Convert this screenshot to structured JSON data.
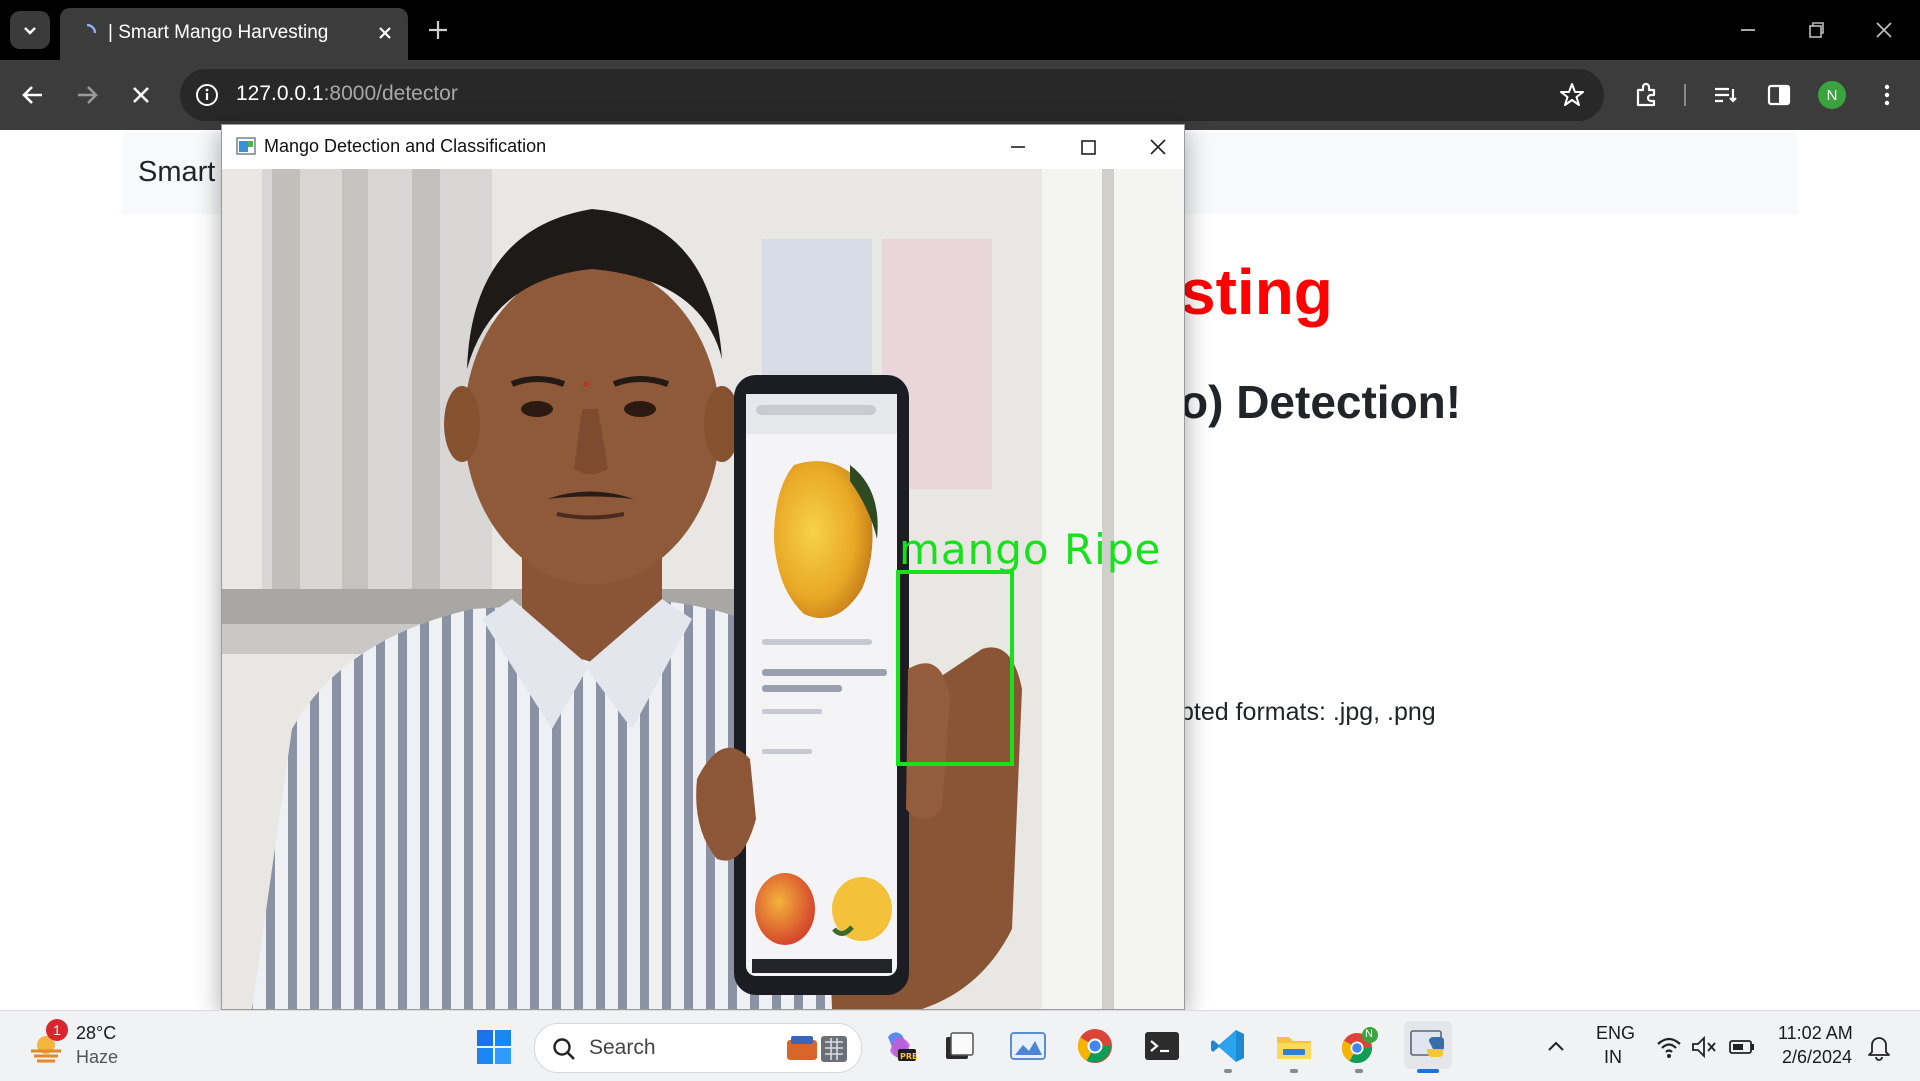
{
  "browser": {
    "tab_title": "| Smart Mango Harvesting",
    "url_host": "127.0.0.1",
    "url_path": ":8000/detector",
    "profile_initial": "N"
  },
  "page": {
    "navbar_brand": "Smart",
    "heading_fragment": "sting",
    "subheading_fragment": "o) Detection!",
    "formats_fragment": "pted formats: .jpg, .png"
  },
  "popup": {
    "title": "Mango Detection and Classification",
    "detection_label": "mango  Ripe"
  },
  "taskbar": {
    "weather_badge": "1",
    "temperature": "28°C",
    "condition": "Haze",
    "search_placeholder": "Search",
    "lang_primary": "ENG",
    "lang_secondary": "IN",
    "time": "11:02 AM",
    "date": "2/6/2024",
    "chrome_badge": "N"
  },
  "colors": {
    "heading_red": "#ff0000",
    "detection_green": "#17e11b",
    "chrome_dark": "#3c3c3c"
  }
}
